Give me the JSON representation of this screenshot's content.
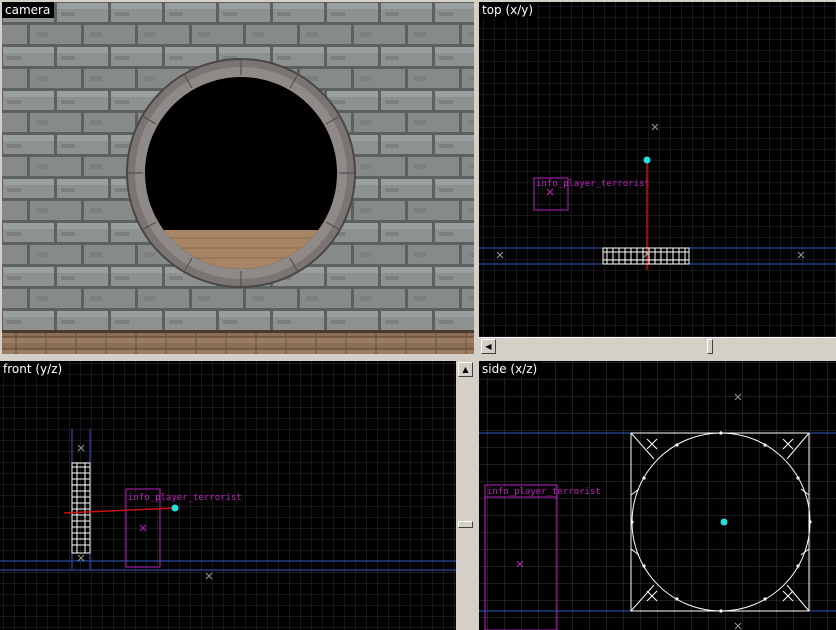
{
  "viewports": {
    "camera": {
      "label": "camera"
    },
    "top": {
      "label": "top (x/y)"
    },
    "front": {
      "label": "front (y/z)"
    },
    "side": {
      "label": "side (x/z)"
    }
  },
  "entity": {
    "classname": "info_player_terrorist"
  },
  "colors": {
    "grid": "#2c2c2c",
    "grid_major": "#3a3a3a",
    "axis_blue": "#3358c8",
    "entity_magenta": "#c020c0",
    "selection_red": "#cc1010",
    "camera_cyan": "#20e0e0",
    "brush_white": "#ffffff",
    "stone": "#8a8f8e",
    "mortar": "#5f6463"
  },
  "icons": {
    "scroll_left": "arrow-left-icon",
    "scroll_up": "arrow-up-icon"
  }
}
